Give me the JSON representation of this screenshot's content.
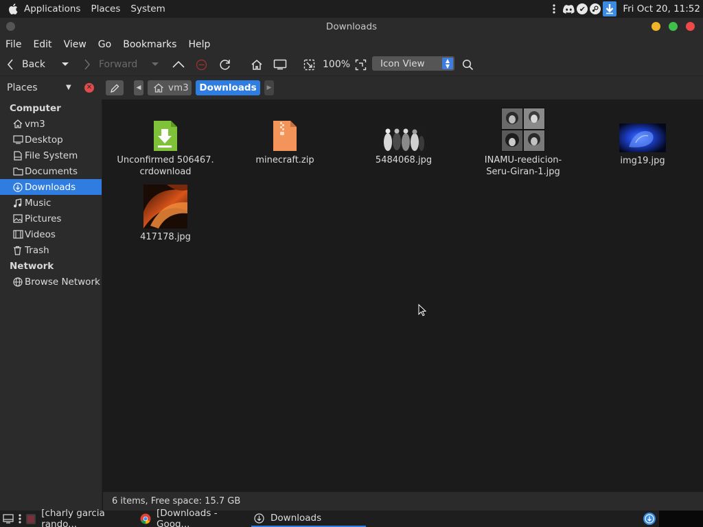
{
  "top_panel": {
    "menus": [
      "Applications",
      "Places",
      "System"
    ],
    "clock": "Fri Oct 20, 11:52"
  },
  "window": {
    "title": "Downloads"
  },
  "menubar": [
    "File",
    "Edit",
    "View",
    "Go",
    "Bookmarks",
    "Help"
  ],
  "toolbar": {
    "back_label": "Back",
    "forward_label": "Forward",
    "zoom": "100%",
    "view_mode": "Icon View"
  },
  "sidebar": {
    "header": "Places",
    "sections": [
      {
        "title": "Computer",
        "items": [
          {
            "label": "vm3",
            "icon": "home-icon"
          },
          {
            "label": "Desktop",
            "icon": "desktop-icon"
          },
          {
            "label": "File System",
            "icon": "drive-icon"
          },
          {
            "label": "Documents",
            "icon": "folder-icon"
          },
          {
            "label": "Downloads",
            "icon": "download-icon",
            "active": true
          },
          {
            "label": "Music",
            "icon": "music-icon"
          },
          {
            "label": "Pictures",
            "icon": "pictures-icon"
          },
          {
            "label": "Videos",
            "icon": "video-icon"
          },
          {
            "label": "Trash",
            "icon": "trash-icon"
          }
        ]
      },
      {
        "title": "Network",
        "items": [
          {
            "label": "Browse Network",
            "icon": "network-icon"
          }
        ]
      }
    ]
  },
  "breadcrumb": {
    "home": "vm3",
    "current": "Downloads"
  },
  "files": [
    {
      "name_line1": "Unconfirmed 506467.",
      "name_line2": "crdownload",
      "icon": "crdownload-icon"
    },
    {
      "name_line1": "minecraft.zip",
      "name_line2": "",
      "icon": "zip-icon"
    },
    {
      "name_line1": "5484068.jpg",
      "name_line2": "",
      "icon": "band-photo-thumbnail"
    },
    {
      "name_line1": "INAMU-reedicion-",
      "name_line2": "Seru-Giran-1.jpg",
      "icon": "portrait-grid-thumbnail"
    },
    {
      "name_line1": "img19.jpg",
      "name_line2": "",
      "icon": "blue-wallpaper-thumbnail"
    },
    {
      "name_line1": "417178.jpg",
      "name_line2": "",
      "icon": "orange-wallpaper-thumbnail"
    }
  ],
  "statusbar": "6 items, Free space: 15.7 GB",
  "taskbar": {
    "tasks": [
      "[charly garcia rando...",
      "[Downloads - Goog...",
      "Downloads"
    ]
  },
  "colors": {
    "accent": "#2f7de0",
    "background": "#1b1b1b",
    "panel": "#2b2b2b"
  }
}
